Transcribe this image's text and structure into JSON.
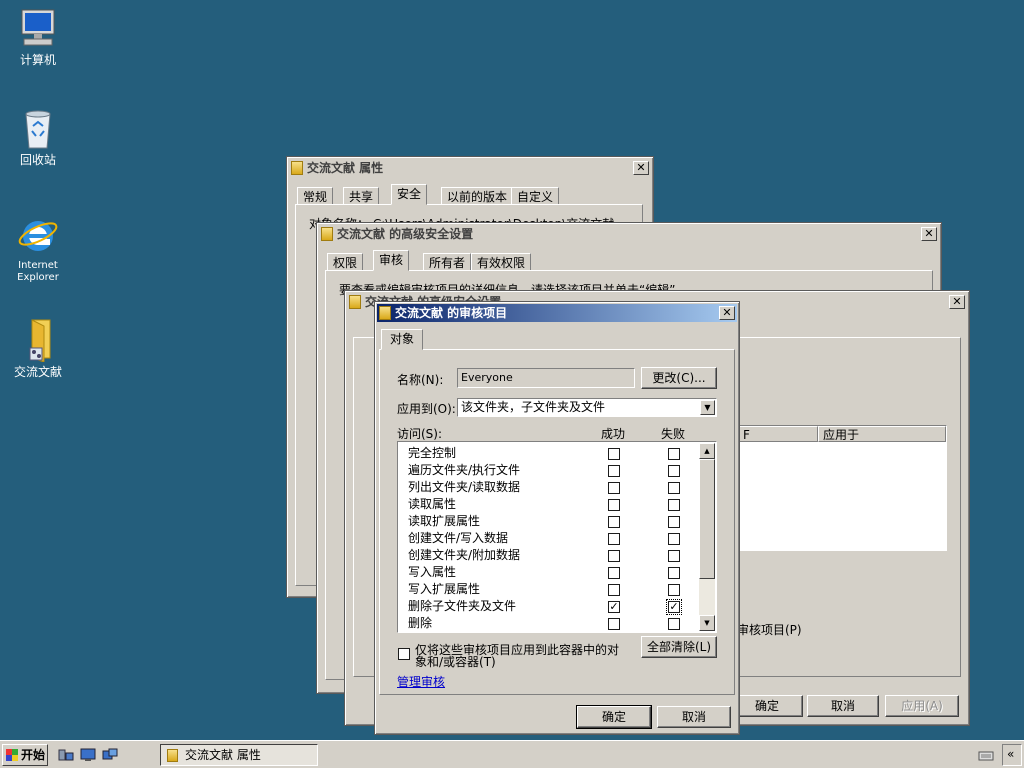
{
  "desktop": {
    "icons": [
      {
        "label": "计算机"
      },
      {
        "label": "回收站"
      },
      {
        "label": "Internet\nExplorer"
      },
      {
        "label": "交流文献"
      }
    ]
  },
  "win_props": {
    "title": "交流文献 属性",
    "tabs": [
      "常规",
      "共享",
      "安全",
      "以前的版本",
      "自定义"
    ],
    "selected_tab": "安全",
    "frag_object_name": "对象名称：    C:\\Users\\Administrator\\Desktop\\交流文献"
  },
  "win_advanced": {
    "title": "交流文献 的高级安全设置",
    "tabs": [
      "权限",
      "审核",
      "所有者",
      "有效权限"
    ],
    "selected_tab": "审核",
    "frag_desc": "要查看或编辑审核项目的详细信息，请选择该项目并单击“编辑”。"
  },
  "win_advanced_edit": {
    "title": "交流文献 的高级安全设置",
    "col_apply": "应用于",
    "frag_col": "F",
    "frag_audit_item": "审核项目(P)",
    "ok": "确定",
    "cancel": "取消",
    "apply": "应用(A)"
  },
  "win_audit_entry": {
    "title": "交流文献 的审核项目",
    "tab": "对象",
    "name_label": "名称(N):",
    "name_value": "Everyone",
    "change_button": "更改(C)...",
    "apply_to_label": "应用到(O):",
    "apply_to_value": "该文件夹，子文件夹及文件",
    "access_label": "访问(S):",
    "col_success": "成功",
    "col_failure": "失败",
    "rows": [
      {
        "label": "完全控制",
        "success": false,
        "failure": false
      },
      {
        "label": "遍历文件夹/执行文件",
        "success": false,
        "failure": false
      },
      {
        "label": "列出文件夹/读取数据",
        "success": false,
        "failure": false
      },
      {
        "label": "读取属性",
        "success": false,
        "failure": false
      },
      {
        "label": "读取扩展属性",
        "success": false,
        "failure": false
      },
      {
        "label": "创建文件/写入数据",
        "success": false,
        "failure": false
      },
      {
        "label": "创建文件夹/附加数据",
        "success": false,
        "failure": false
      },
      {
        "label": "写入属性",
        "success": false,
        "failure": false
      },
      {
        "label": "写入扩展属性",
        "success": false,
        "failure": false
      },
      {
        "label": "删除子文件夹及文件",
        "success": true,
        "failure": true
      },
      {
        "label": "删除",
        "success": false,
        "failure": false
      }
    ],
    "apply_only_line1": "仅将这些审核项目应用到此容器中的对",
    "apply_only_line2": "象和/或容器(T)",
    "clear_all": "全部清除(L)",
    "manage_link": "管理审核",
    "ok": "确定",
    "cancel": "取消"
  },
  "taskbar": {
    "start": "开始",
    "task_title": "交流文献 属性"
  },
  "colors": {
    "desktop": "#245e7c",
    "active_title_start": "#0a246a",
    "active_title_end": "#a6caf0",
    "dialog_face": "#d4d0c8"
  }
}
